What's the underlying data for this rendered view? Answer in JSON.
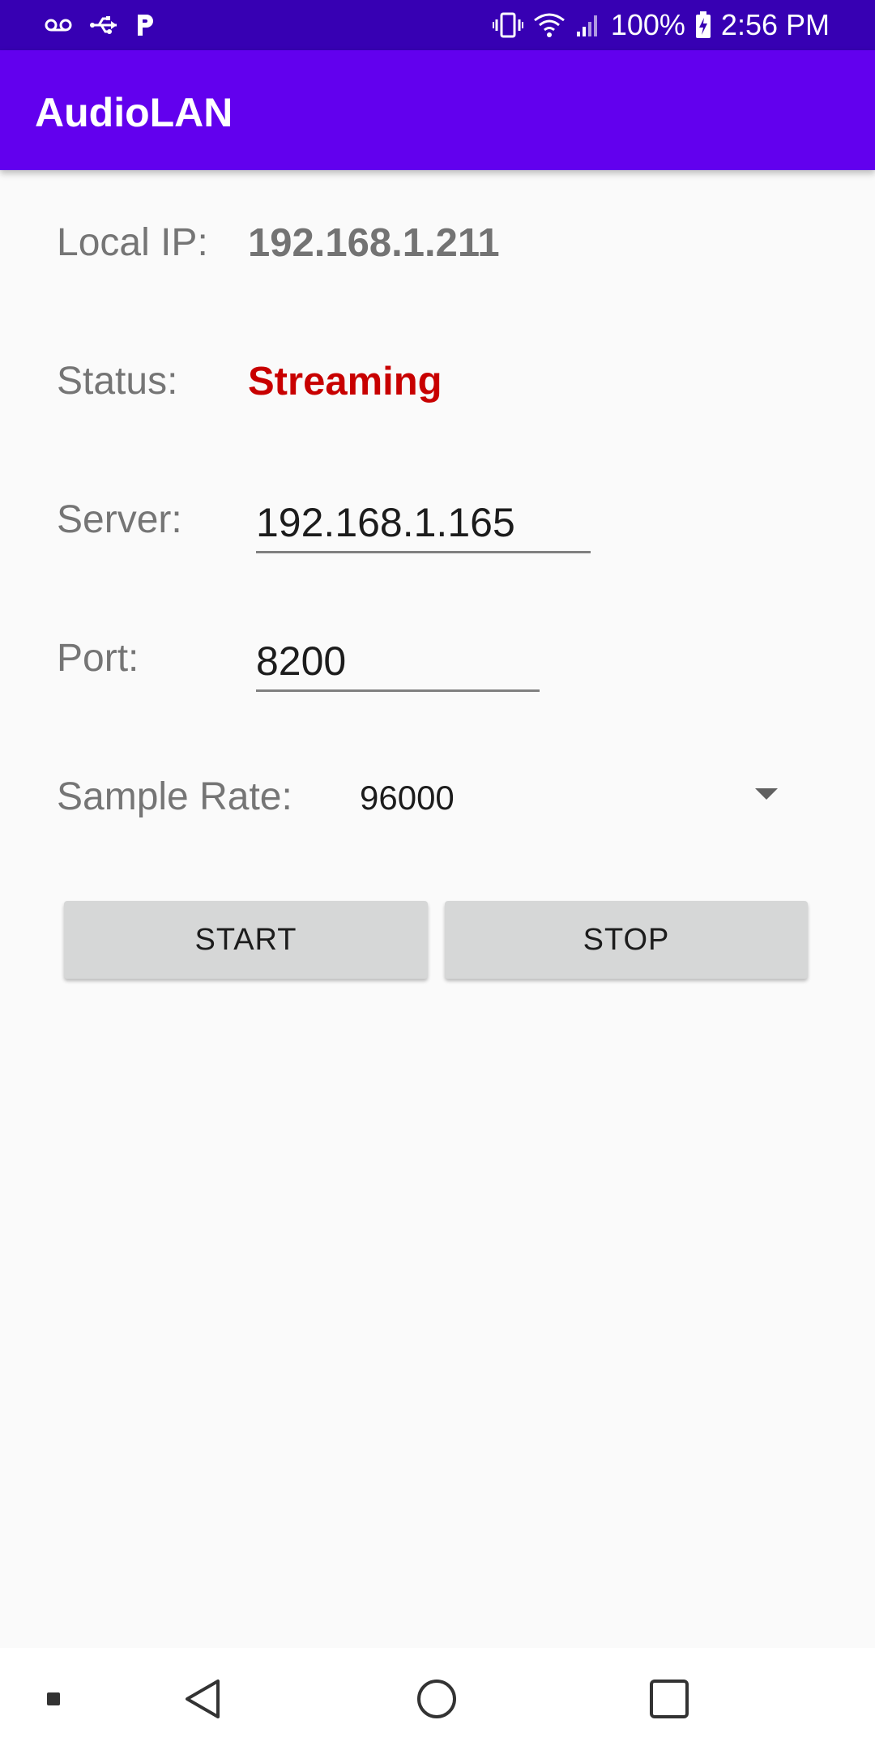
{
  "status_bar": {
    "left_icons": [
      "voicemail-icon",
      "usb-icon",
      "parking-icon"
    ],
    "right_icons": [
      "vibrate-icon",
      "wifi-icon",
      "signal-icon",
      "battery-charging-icon"
    ],
    "battery": "100%",
    "time": "2:56 PM"
  },
  "app_bar": {
    "title": "AudioLAN"
  },
  "form": {
    "local_ip_label": "Local IP:",
    "local_ip_value": "192.168.1.211",
    "status_label": "Status:",
    "status_value": "Streaming",
    "server_label": "Server:",
    "server_value": "192.168.1.165",
    "port_label": "Port:",
    "port_value": "8200",
    "sample_rate_label": "Sample Rate:",
    "sample_rate_value": "96000"
  },
  "buttons": {
    "start_label": "START",
    "stop_label": "STOP"
  },
  "nav_bar": {
    "items": [
      "dot-icon",
      "back-icon",
      "home-icon",
      "recents-icon"
    ]
  },
  "colors": {
    "app_bar": "#6200ee",
    "status_bar": "#3700b3",
    "status_value": "#c80000",
    "button": "#d6d7d7",
    "background": "#fafafa"
  }
}
